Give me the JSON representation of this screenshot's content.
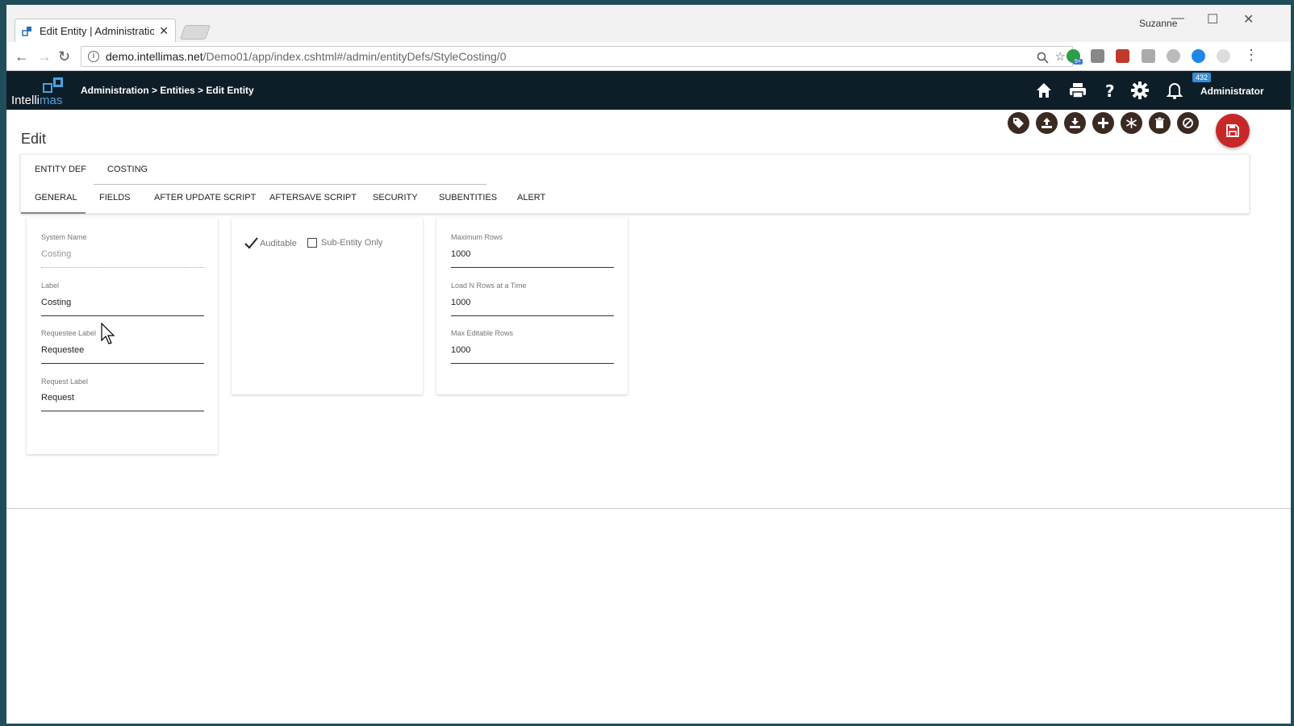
{
  "browser": {
    "tab_title": "Edit Entity | Administratio",
    "user": "Suzanne",
    "url_host": "demo.intellimas.net",
    "url_path": "/Demo01/app/index.cshtml#/admin/entityDefs/StyleCosting/0",
    "extension_badge": "9+"
  },
  "app": {
    "logo_text_a": "Intelli",
    "logo_text_b": "mas",
    "breadcrumb": "Administration > Entities > Edit Entity",
    "notification_count": "432",
    "user_menu": "Administrator"
  },
  "page": {
    "title": "Edit"
  },
  "tabs_top": [
    "ENTITY DEF",
    "COSTING"
  ],
  "tabs_sub": [
    "GENERAL",
    "FIELDS",
    "AFTER UPDATE SCRIPT",
    "AFTERSAVE SCRIPT",
    "SECURITY",
    "SUBENTITIES",
    "ALERT"
  ],
  "form_left": {
    "system_name_label": "System Name",
    "system_name_value": "Costing",
    "label_label": "Label",
    "label_value": "Costing",
    "requestee_label_label": "Requestee Label",
    "requestee_label_value": "Requestee",
    "request_label_label": "Request Label",
    "request_label_value": "Request"
  },
  "form_middle": {
    "auditable_label": "Auditable",
    "auditable_checked": true,
    "sub_entity_label": "Sub-Entity Only",
    "sub_entity_checked": false
  },
  "form_right": {
    "max_rows_label": "Maximum Rows",
    "max_rows_value": "1000",
    "load_n_label": "Load N Rows at a Time",
    "load_n_value": "1000",
    "max_editable_label": "Max Editable Rows",
    "max_editable_value": "1000"
  },
  "colors": {
    "header_bg": "#0e1e29",
    "action_btn": "#3b2a22",
    "save_btn": "#c62828",
    "accent_blue": "#4aa3df"
  }
}
